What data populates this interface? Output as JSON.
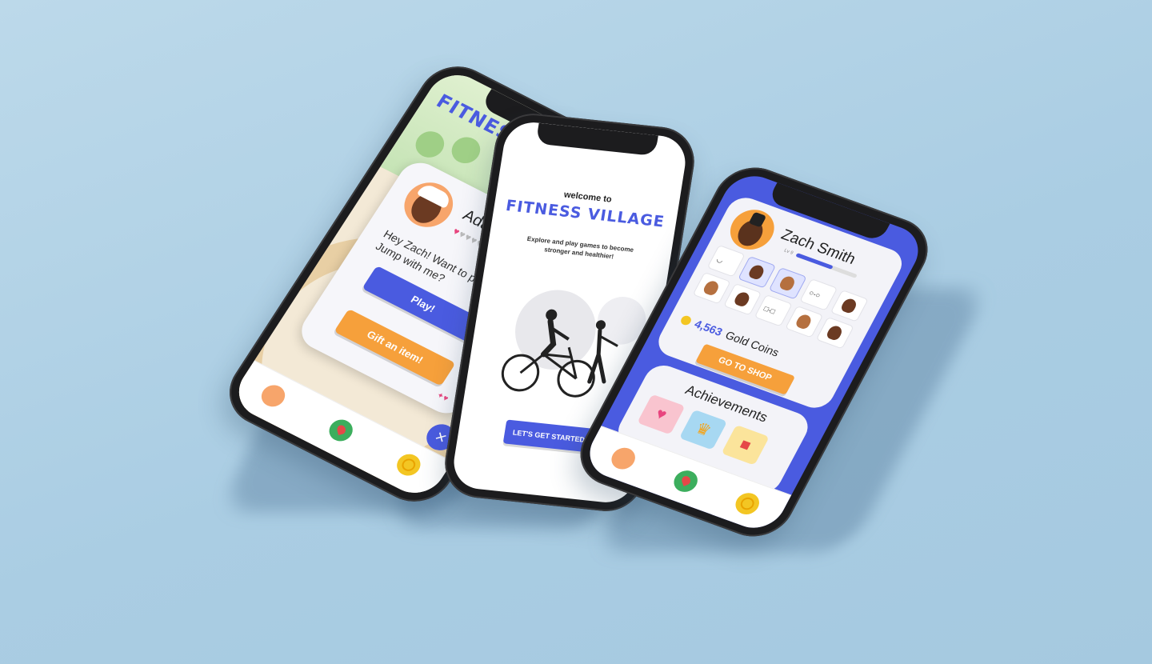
{
  "brand": {
    "primary": "#4a5be0",
    "accent": "#f6a03b",
    "logo_text": "FITNESS VILLAGE"
  },
  "left_phone": {
    "logo": "FITNESS VILLAGE",
    "dialog": {
      "npc_name": "Adam",
      "hearts_filled": 1,
      "hearts_total": 5,
      "message": "Hey Zach! Want to play Log Jump with me?",
      "play_label": "Play!",
      "gift_label": "Gift an item!"
    },
    "close_icon": "close-icon",
    "tabs": [
      "avatar-tab",
      "map-pin-tab",
      "coin-tab"
    ]
  },
  "center_phone": {
    "welcome": "welcome to",
    "logo": "FITNESS VILLAGE",
    "tagline": "Explore and play games to become stronger and healthier!",
    "start_label": "LET'S GET STARTED!"
  },
  "right_phone": {
    "user_name": "Zach Smith",
    "level_label": "Lv 9",
    "level_progress": 0.6,
    "coins_value": "4,563",
    "coins_label": "Gold Coins",
    "shop_label": "GO TO SHOP",
    "achievements_title": "Achievements",
    "achievements": [
      "heart-icon",
      "crown-icon",
      "gift-icon"
    ]
  }
}
